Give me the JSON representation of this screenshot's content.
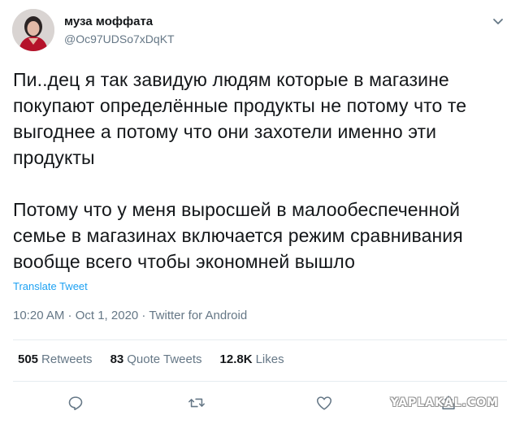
{
  "user": {
    "display_name": "муза моффата",
    "handle": "@Oc97UDSo7xDqKT"
  },
  "tweet": {
    "paragraphs": [
      "Пи..дец я так завидую людям которые в магазине\nпокупают определённые продукты не потому что те\nвыгоднее а потому что они захотели именно эти\nпродукты",
      "Потому что у меня выросшей в малообеспеченной\nсемье в магазинах включается режим сравнивания\nвообще всего чтобы экономней вышло"
    ],
    "translate_label": "Translate Tweet",
    "meta": "10:20 AM · Oct 1, 2020 · Twitter for Android"
  },
  "stats": {
    "retweets": {
      "count": "505",
      "label": "Retweets"
    },
    "quote_tweets": {
      "count": "83",
      "label": "Quote Tweets"
    },
    "likes": {
      "count": "12.8K",
      "label": "Likes"
    }
  },
  "actions": {
    "icons": [
      "reply-icon",
      "retweet-icon",
      "like-icon",
      "share-icon"
    ]
  },
  "watermark": "YAPLAKAL.COM",
  "colors": {
    "text": "#14171a",
    "secondary": "#657786",
    "accent": "#1da1f2",
    "divider": "#e6ecf0"
  }
}
